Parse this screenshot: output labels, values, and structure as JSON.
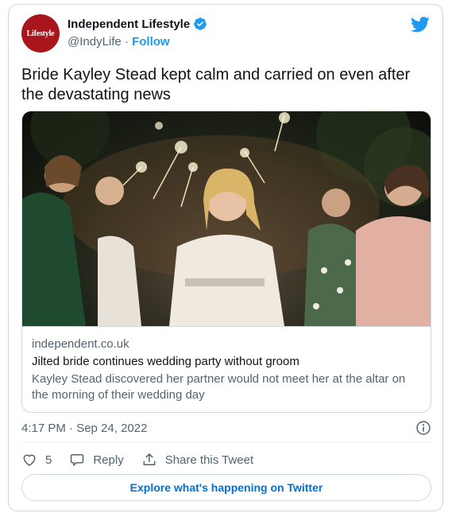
{
  "account": {
    "avatar_text": "Lifestyle",
    "display_name": "Independent Lifestyle",
    "handle": "@IndyLife",
    "separator": "·",
    "follow_label": "Follow"
  },
  "tweet": {
    "text": "Bride Kayley Stead kept calm and carried on even after the devastating news",
    "timestamp": "4:17 PM · Sep 24, 2022"
  },
  "link_card": {
    "domain": "independent.co.uk",
    "title": "Jilted bride continues wedding party without groom",
    "description": "Kayley Stead discovered her partner would not meet her at the altar on the morning of their wedding day"
  },
  "actions": {
    "like_count": "5",
    "reply_label": "Reply",
    "share_label": "Share this Tweet"
  },
  "explore_label": "Explore what's happening on Twitter",
  "colors": {
    "accent": "#1d9bf0",
    "link_blue": "#006fd6",
    "avatar_bg": "#a8161c",
    "secondary_text": "#536471",
    "border": "#cfd9de"
  },
  "icons": {
    "verified": "verified-badge-icon",
    "logo": "twitter-bird-icon",
    "info": "info-icon",
    "like": "heart-icon",
    "reply": "speech-bubble-icon",
    "share": "share-upload-icon"
  }
}
